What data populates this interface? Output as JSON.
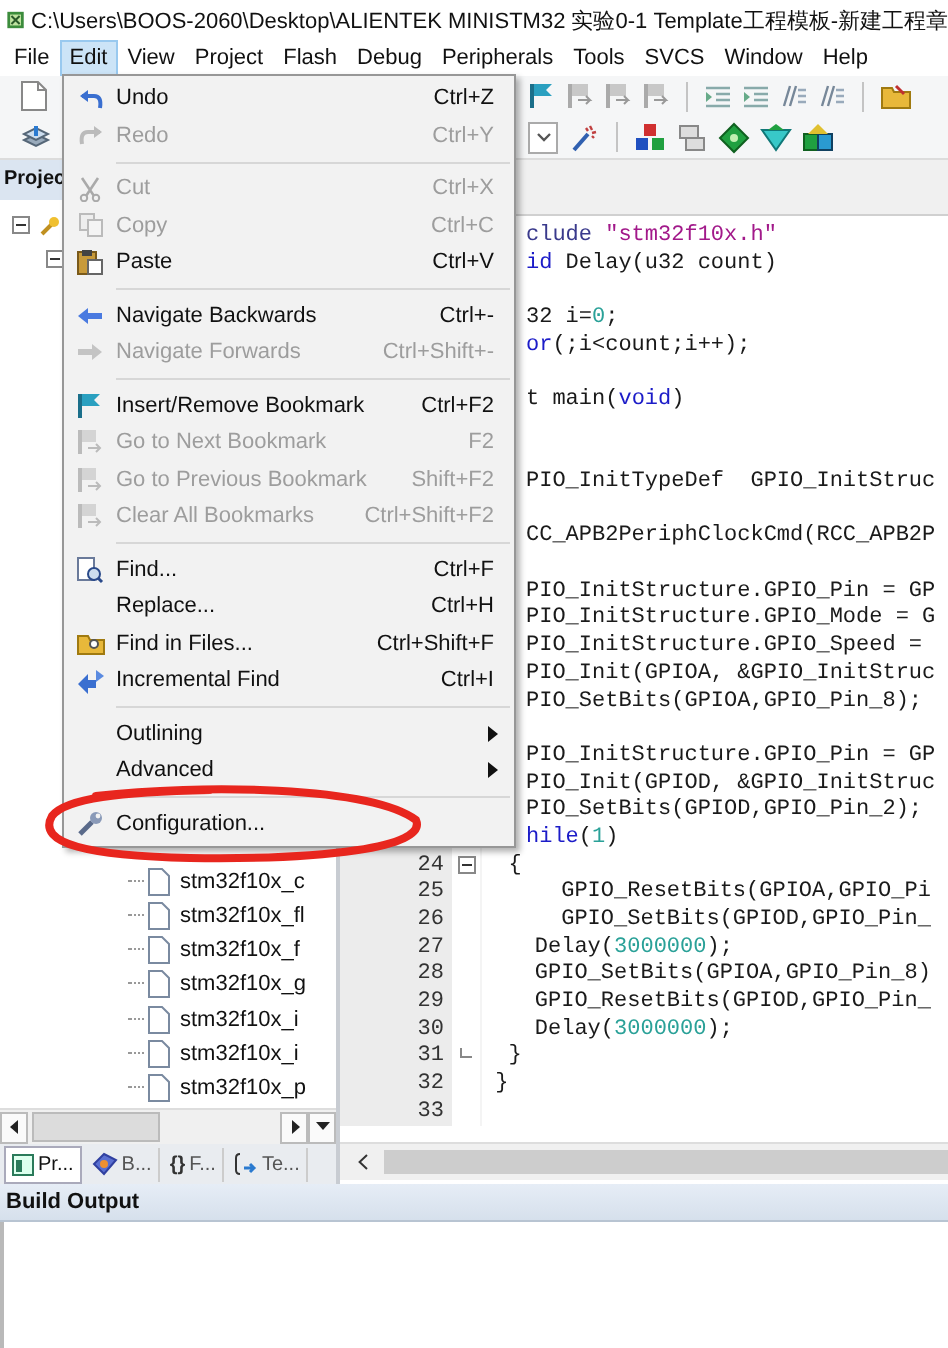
{
  "window": {
    "title": "C:\\Users\\BOOS-2060\\Desktop\\ALIENTEK MINISTM32 实验0-1 Template工程模板-新建工程章"
  },
  "menu_bar": [
    {
      "label": "File",
      "selected": false
    },
    {
      "label": "Edit",
      "selected": true
    },
    {
      "label": "View",
      "selected": false
    },
    {
      "label": "Project",
      "selected": false
    },
    {
      "label": "Flash",
      "selected": false
    },
    {
      "label": "Debug",
      "selected": false
    },
    {
      "label": "Peripherals",
      "selected": false
    },
    {
      "label": "Tools",
      "selected": false
    },
    {
      "label": "SVCS",
      "selected": false
    },
    {
      "label": "Window",
      "selected": false
    },
    {
      "label": "Help",
      "selected": false
    }
  ],
  "edit_menu": {
    "items": [
      {
        "kind": "item",
        "label": "Undo",
        "shortcut": "Ctrl+Z",
        "disabled": false
      },
      {
        "kind": "item",
        "label": "Redo",
        "shortcut": "Ctrl+Y",
        "disabled": true
      },
      {
        "kind": "separator"
      },
      {
        "kind": "item",
        "label": "Cut",
        "shortcut": "Ctrl+X",
        "disabled": true
      },
      {
        "kind": "item",
        "label": "Copy",
        "shortcut": "Ctrl+C",
        "disabled": true
      },
      {
        "kind": "item",
        "label": "Paste",
        "shortcut": "Ctrl+V",
        "disabled": false
      },
      {
        "kind": "separator"
      },
      {
        "kind": "item",
        "label": "Navigate Backwards",
        "shortcut": "Ctrl+-",
        "disabled": false
      },
      {
        "kind": "item",
        "label": "Navigate Forwards",
        "shortcut": "Ctrl+Shift+-",
        "disabled": true
      },
      {
        "kind": "separator"
      },
      {
        "kind": "item",
        "label": "Insert/Remove Bookmark",
        "shortcut": "Ctrl+F2",
        "disabled": false
      },
      {
        "kind": "item",
        "label": "Go to Next Bookmark",
        "shortcut": "F2",
        "disabled": true
      },
      {
        "kind": "item",
        "label": "Go to Previous Bookmark",
        "shortcut": "Shift+F2",
        "disabled": true
      },
      {
        "kind": "item",
        "label": "Clear All Bookmarks",
        "shortcut": "Ctrl+Shift+F2",
        "disabled": true
      },
      {
        "kind": "separator"
      },
      {
        "kind": "item",
        "label": "Find...",
        "shortcut": "Ctrl+F",
        "disabled": false
      },
      {
        "kind": "item",
        "label": "Replace...",
        "shortcut": "Ctrl+H",
        "disabled": false
      },
      {
        "kind": "item",
        "label": "Find in Files...",
        "shortcut": "Ctrl+Shift+F",
        "disabled": false
      },
      {
        "kind": "item",
        "label": "Incremental Find",
        "shortcut": "Ctrl+I",
        "disabled": false
      },
      {
        "kind": "separator"
      },
      {
        "kind": "submenu",
        "label": "Outlining",
        "disabled": false
      },
      {
        "kind": "submenu",
        "label": "Advanced",
        "disabled": false
      },
      {
        "kind": "separator"
      },
      {
        "kind": "item",
        "label": "Configuration...",
        "disabled": false
      }
    ]
  },
  "project_panel": {
    "title": "Projec",
    "files": [
      "stm32f10x_c",
      "stm32f10x_fl",
      "stm32f10x_f",
      "stm32f10x_g",
      "stm32f10x_i",
      "stm32f10x_i",
      "stm32f10x_p"
    ],
    "tabs": [
      {
        "label": "Pr...",
        "selected": true
      },
      {
        "label": "B...",
        "selected": false
      },
      {
        "icon_text": "{}",
        "label": "F...",
        "selected": false
      },
      {
        "label": "Te...",
        "selected": false
      }
    ]
  },
  "editor": {
    "lines": [
      {
        "kind": "clipped",
        "segments": [
          {
            "text": "clude ",
            "kind": "directive"
          },
          {
            "text": "\"stm32f10x.h\"",
            "kind": "string"
          }
        ]
      },
      {
        "kind": "clipped",
        "segments": [
          {
            "text": "id",
            "kind": "keyword"
          },
          {
            "text": " Delay(u32 count)",
            "kind": "plain"
          }
        ]
      },
      {
        "kind": "blank"
      },
      {
        "kind": "clipped",
        "segments": [
          {
            "text": "32 i=",
            "kind": "plain"
          },
          {
            "text": "0",
            "kind": "number"
          },
          {
            "text": ";",
            "kind": "plain"
          }
        ]
      },
      {
        "kind": "clipped",
        "segments": [
          {
            "text": "or",
            "kind": "keyword"
          },
          {
            "text": "(;i<count;i++);",
            "kind": "plain"
          }
        ]
      },
      {
        "kind": "blank"
      },
      {
        "kind": "clipped",
        "segments": [
          {
            "text": "t main(",
            "kind": "plain"
          },
          {
            "text": "void",
            "kind": "keyword"
          },
          {
            "text": ")",
            "kind": "plain"
          }
        ]
      },
      {
        "kind": "blank"
      },
      {
        "kind": "blank"
      },
      {
        "kind": "clipped",
        "segments": [
          {
            "text": "PIO_InitTypeDef  GPIO_InitStruc",
            "kind": "plain"
          }
        ]
      },
      {
        "kind": "blank"
      },
      {
        "kind": "clipped",
        "segments": [
          {
            "text": "CC_APB2PeriphClockCmd(RCC_APB2P",
            "kind": "plain"
          }
        ]
      },
      {
        "kind": "blank"
      },
      {
        "kind": "clipped",
        "segments": [
          {
            "text": "PIO_InitStructure.GPIO_Pin = GP",
            "kind": "plain"
          }
        ]
      },
      {
        "kind": "clipped",
        "segments": [
          {
            "text": "PIO_InitStructure.GPIO_Mode = G",
            "kind": "plain"
          }
        ]
      },
      {
        "kind": "clipped",
        "segments": [
          {
            "text": "PIO_InitStructure.GPIO_Speed =",
            "kind": "plain"
          }
        ]
      },
      {
        "kind": "clipped",
        "segments": [
          {
            "text": "PIO_Init(GPIOA, &GPIO_InitStruc",
            "kind": "plain"
          }
        ]
      },
      {
        "kind": "clipped",
        "segments": [
          {
            "text": "PIO_SetBits(GPIOA,GPIO_Pin_8);",
            "kind": "plain"
          }
        ]
      },
      {
        "kind": "blank"
      },
      {
        "kind": "clipped",
        "segments": [
          {
            "text": "PIO_InitStructure.GPIO_Pin = GP",
            "kind": "plain"
          }
        ]
      },
      {
        "kind": "clipped",
        "segments": [
          {
            "text": "PIO_Init(GPIOD, &GPIO_InitStruc",
            "kind": "plain"
          }
        ]
      },
      {
        "kind": "clipped",
        "segments": [
          {
            "text": "PIO_SetBits(GPIOD,GPIO_Pin_2);",
            "kind": "plain"
          }
        ]
      },
      {
        "kind": "clipped",
        "segments": [
          {
            "text": "hile",
            "kind": "keyword"
          },
          {
            "text": "(",
            "kind": "plain"
          },
          {
            "text": "1",
            "kind": "number"
          },
          {
            "text": ")",
            "kind": "plain"
          }
        ]
      },
      {
        "kind": "numbered",
        "number": "24",
        "fold_start": true,
        "segments": [
          {
            "text": "  {",
            "kind": "plain"
          }
        ]
      },
      {
        "kind": "numbered",
        "number": "25",
        "segments": [
          {
            "text": "      GPIO_ResetBits(GPIOA,GPIO_Pi",
            "kind": "plain"
          }
        ]
      },
      {
        "kind": "numbered",
        "number": "26",
        "segments": [
          {
            "text": "      GPIO_SetBits(GPIOD,GPIO_Pin_",
            "kind": "plain"
          }
        ]
      },
      {
        "kind": "numbered",
        "number": "27",
        "segments": [
          {
            "text": "    Delay(",
            "kind": "plain"
          },
          {
            "text": "3000000",
            "kind": "number"
          },
          {
            "text": ");",
            "kind": "plain"
          }
        ]
      },
      {
        "kind": "numbered",
        "number": "28",
        "segments": [
          {
            "text": "    GPIO_SetBits(GPIOA,GPIO_Pin_8)",
            "kind": "plain"
          }
        ]
      },
      {
        "kind": "numbered",
        "number": "29",
        "segments": [
          {
            "text": "    GPIO_ResetBits(GPIOD,GPIO_Pin_",
            "kind": "plain"
          }
        ]
      },
      {
        "kind": "numbered",
        "number": "30",
        "segments": [
          {
            "text": "    Delay(",
            "kind": "plain"
          },
          {
            "text": "3000000",
            "kind": "number"
          },
          {
            "text": ");",
            "kind": "plain"
          }
        ]
      },
      {
        "kind": "numbered",
        "number": "31",
        "fold_end": true,
        "segments": [
          {
            "text": "  }",
            "kind": "plain"
          }
        ]
      },
      {
        "kind": "numbered",
        "number": "32",
        "segments": [
          {
            "text": " }",
            "kind": "plain"
          }
        ]
      },
      {
        "kind": "numbered",
        "number": "33"
      }
    ]
  },
  "build_output": {
    "title": "Build Output"
  }
}
